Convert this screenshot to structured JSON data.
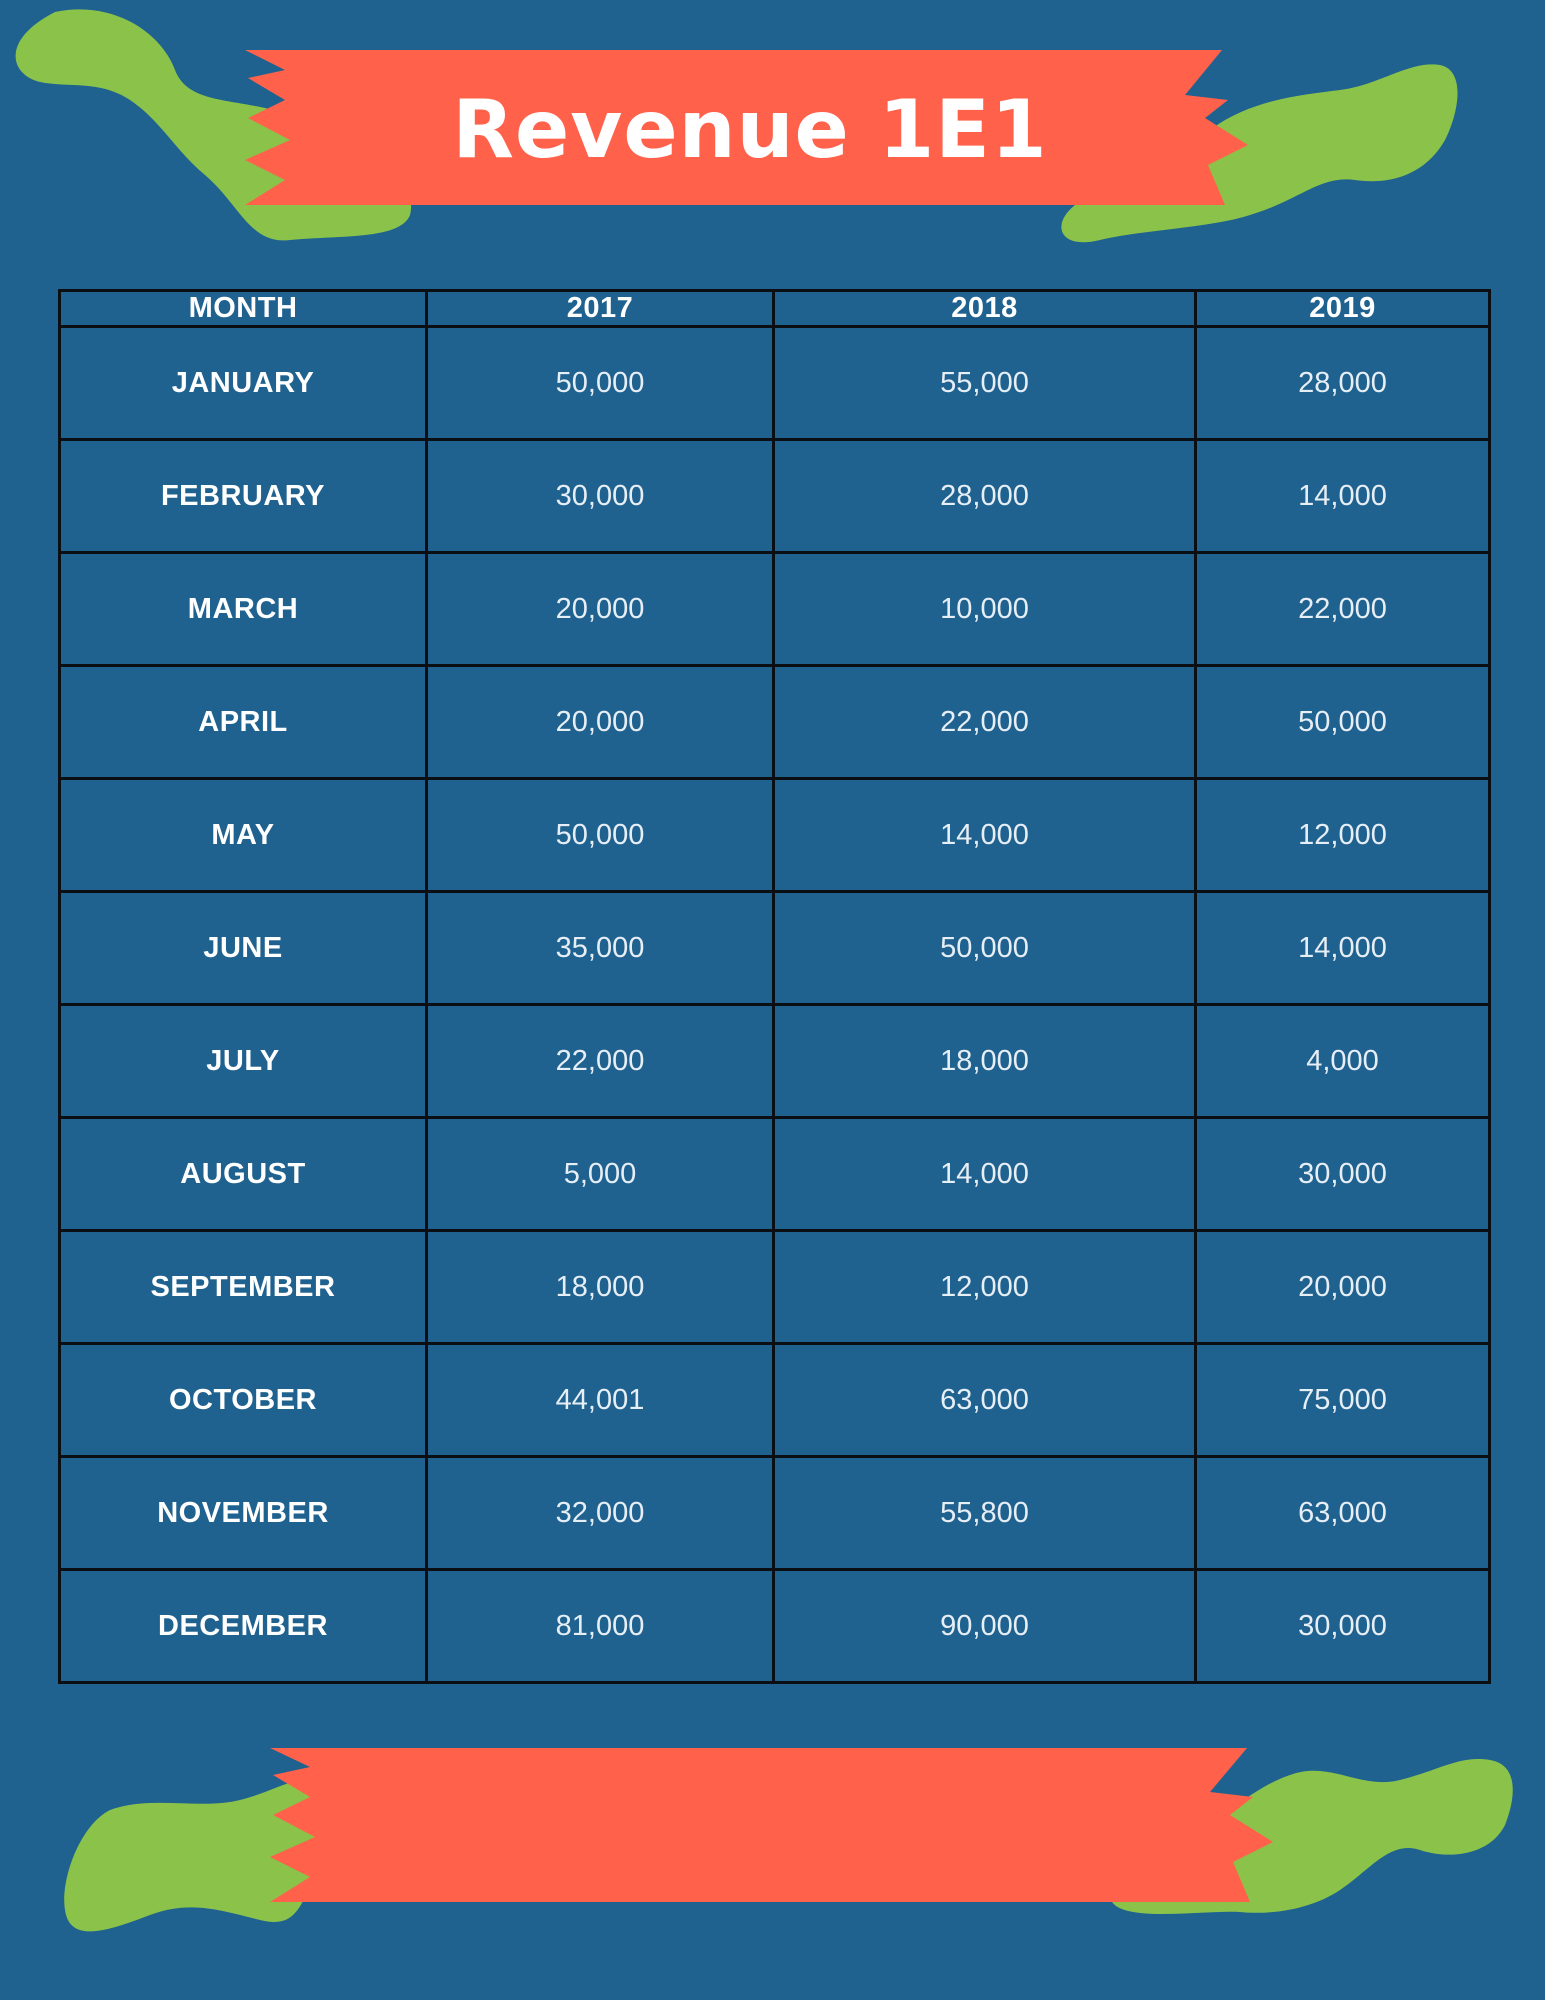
{
  "title": "Revenue 1E1",
  "colors": {
    "background": "#20628f",
    "ribbon": "#ff614a",
    "blob": "#8bc34a",
    "text": "#ffffff"
  },
  "table": {
    "headers": [
      "MONTH",
      "2017",
      "2018",
      "2019"
    ],
    "rows": [
      {
        "month": "JANUARY",
        "v2017": "50,000",
        "v2018": "55,000",
        "v2019": "28,000"
      },
      {
        "month": "FEBRUARY",
        "v2017": "30,000",
        "v2018": "28,000",
        "v2019": "14,000"
      },
      {
        "month": "MARCH",
        "v2017": "20,000",
        "v2018": "10,000",
        "v2019": "22,000"
      },
      {
        "month": "APRIL",
        "v2017": "20,000",
        "v2018": "22,000",
        "v2019": "50,000"
      },
      {
        "month": "MAY",
        "v2017": "50,000",
        "v2018": "14,000",
        "v2019": "12,000"
      },
      {
        "month": "JUNE",
        "v2017": "35,000",
        "v2018": "50,000",
        "v2019": "14,000"
      },
      {
        "month": "JULY",
        "v2017": "22,000",
        "v2018": "18,000",
        "v2019": "4,000"
      },
      {
        "month": "AUGUST",
        "v2017": "5,000",
        "v2018": "14,000",
        "v2019": "30,000"
      },
      {
        "month": "SEPTEMBER",
        "v2017": "18,000",
        "v2018": "12,000",
        "v2019": "20,000"
      },
      {
        "month": "OCTOBER",
        "v2017": "44,001",
        "v2018": "63,000",
        "v2019": "75,000"
      },
      {
        "month": "NOVEMBER",
        "v2017": "32,000",
        "v2018": "55,800",
        "v2019": "63,000"
      },
      {
        "month": "DECEMBER",
        "v2017": "81,000",
        "v2018": "90,000",
        "v2019": "30,000"
      }
    ]
  }
}
